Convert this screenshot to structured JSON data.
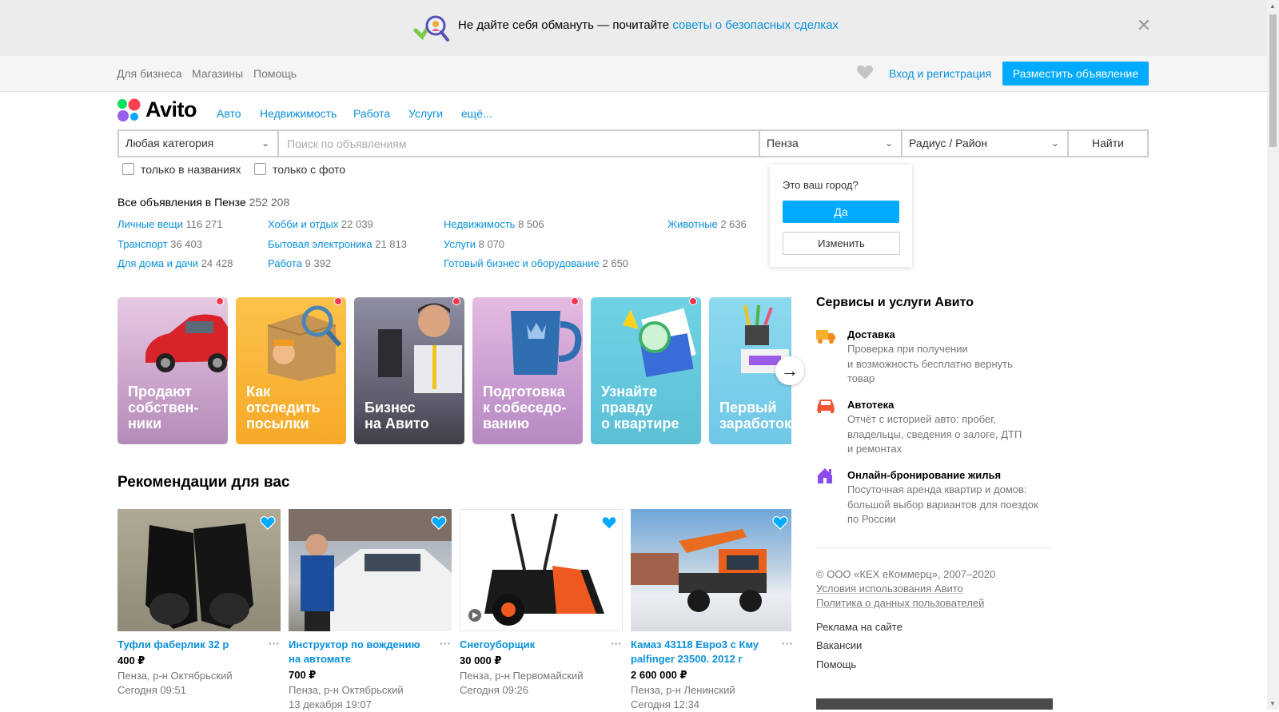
{
  "banner": {
    "text": "Не дайте себя обмануть — почитайте ",
    "link": "советы о безопасных сделках",
    "close": "✕"
  },
  "topbar": {
    "links": [
      "Для бизнеса",
      "Магазины",
      "Помощь"
    ],
    "login": "Вход и регистрация",
    "post_button": "Разместить объявление"
  },
  "logo": {
    "text": "Avito"
  },
  "nav": [
    "Авто",
    "Недвижимость",
    "Работа",
    "Услуги",
    "ещё..."
  ],
  "search": {
    "category": "Любая категория",
    "placeholder": "Поиск по объявлениям",
    "city": "Пенза",
    "radius": "Радиус / Район",
    "find": "Найти",
    "only_titles": "только в названиях",
    "only_photo": "только с фото"
  },
  "city_popup": {
    "question": "Это ваш город?",
    "yes": "Да",
    "change": "Изменить"
  },
  "categories": {
    "all_label": "Все объявления в Пензе",
    "all_count": "252 208",
    "items": [
      {
        "name": "Личные вещи",
        "count": "116 271"
      },
      {
        "name": "Транспорт",
        "count": "36 403"
      },
      {
        "name": "Для дома и дачи",
        "count": "24 428"
      },
      {
        "name": "Хобби и отдых",
        "count": "22 039"
      },
      {
        "name": "Бытовая электроника",
        "count": "21 813"
      },
      {
        "name": "Работа",
        "count": "9 392"
      },
      {
        "name": "Недвижимость",
        "count": "8 506"
      },
      {
        "name": "Услуги",
        "count": "8 070"
      },
      {
        "name": "Готовый бизнес и оборудование",
        "count": "2 650"
      },
      {
        "name": "Животные",
        "count": "2 636"
      }
    ]
  },
  "stories": [
    {
      "title": "Продают собствен-ники",
      "l1": "Продают",
      "l2": "собствен-",
      "l3": "ники"
    },
    {
      "title": "Как отследить посылки",
      "l1": "Как",
      "l2": "отследить",
      "l3": "посылки"
    },
    {
      "title": "Бизнес на Авито",
      "l1": "",
      "l2": "Бизнес",
      "l3": "на Авито"
    },
    {
      "title": "Подготовка к собеседо-ванию",
      "l1": "Подготовка",
      "l2": "к собеседо-",
      "l3": "ванию"
    },
    {
      "title": "Узнайте правду о квартире",
      "l1": "Узнайте",
      "l2": "правду",
      "l3": "о квартире"
    },
    {
      "title": "Первый заработок",
      "l1": "",
      "l2": "Первый",
      "l3": "заработок"
    }
  ],
  "recommendations": {
    "title": "Рекомендации для вас",
    "items": [
      {
        "title1": "Туфли фаберлик 32 р",
        "title2": "",
        "price": "400 ₽",
        "location": "Пенза, р-н Октябрьский",
        "date": "Сегодня 09:51"
      },
      {
        "title1": "Инструктор по вождению",
        "title2": "на автомате",
        "price": "700 ₽",
        "location": "Пенза, р-н Октябрьский",
        "date": "13 декабря 19:07"
      },
      {
        "title1": "Снегоуборщик",
        "title2": "",
        "price": "30 000 ₽",
        "location": "Пенза, р-н Первомайский",
        "date": "Сегодня 09:26"
      },
      {
        "title1": "Камаз 43118 Евро3 с Кму",
        "title2": "palfinger 23500. 2012 г",
        "price": "2 600 000 ₽",
        "location": "Пенза, р-н Ленинский",
        "date": "Сегодня 12:34"
      }
    ]
  },
  "sidebar": {
    "title": "Сервисы и услуги Авито",
    "services": [
      {
        "icon": "truck-icon",
        "name": "Доставка",
        "d1": "Проверка при получении",
        "d2": "и возможность бесплатно вернуть",
        "d3": "товар"
      },
      {
        "icon": "car-icon",
        "name": "Автотека",
        "d1": "Отчёт с историей авто: пробег,",
        "d2": "владельцы, сведения о залоге, ДТП",
        "d3": "и ремонтах"
      },
      {
        "icon": "house-icon",
        "name": "Онлайн-бронирование жилья",
        "d1": "Посуточная аренда квартир и домов:",
        "d2": "большой выбор вариантов для поездок",
        "d3": "по России"
      }
    ],
    "copyright": "© ООО «КЕХ еКоммерц», 2007–2020",
    "terms": "Условия использования Авито",
    "policy": "Политика о данных пользователей",
    "links": [
      "Реклама на сайте",
      "Вакансии",
      "Помощь"
    ]
  },
  "colors": {
    "accent": "#00aaff",
    "link": "#0a90da",
    "notify_dot": "#f4374d"
  }
}
